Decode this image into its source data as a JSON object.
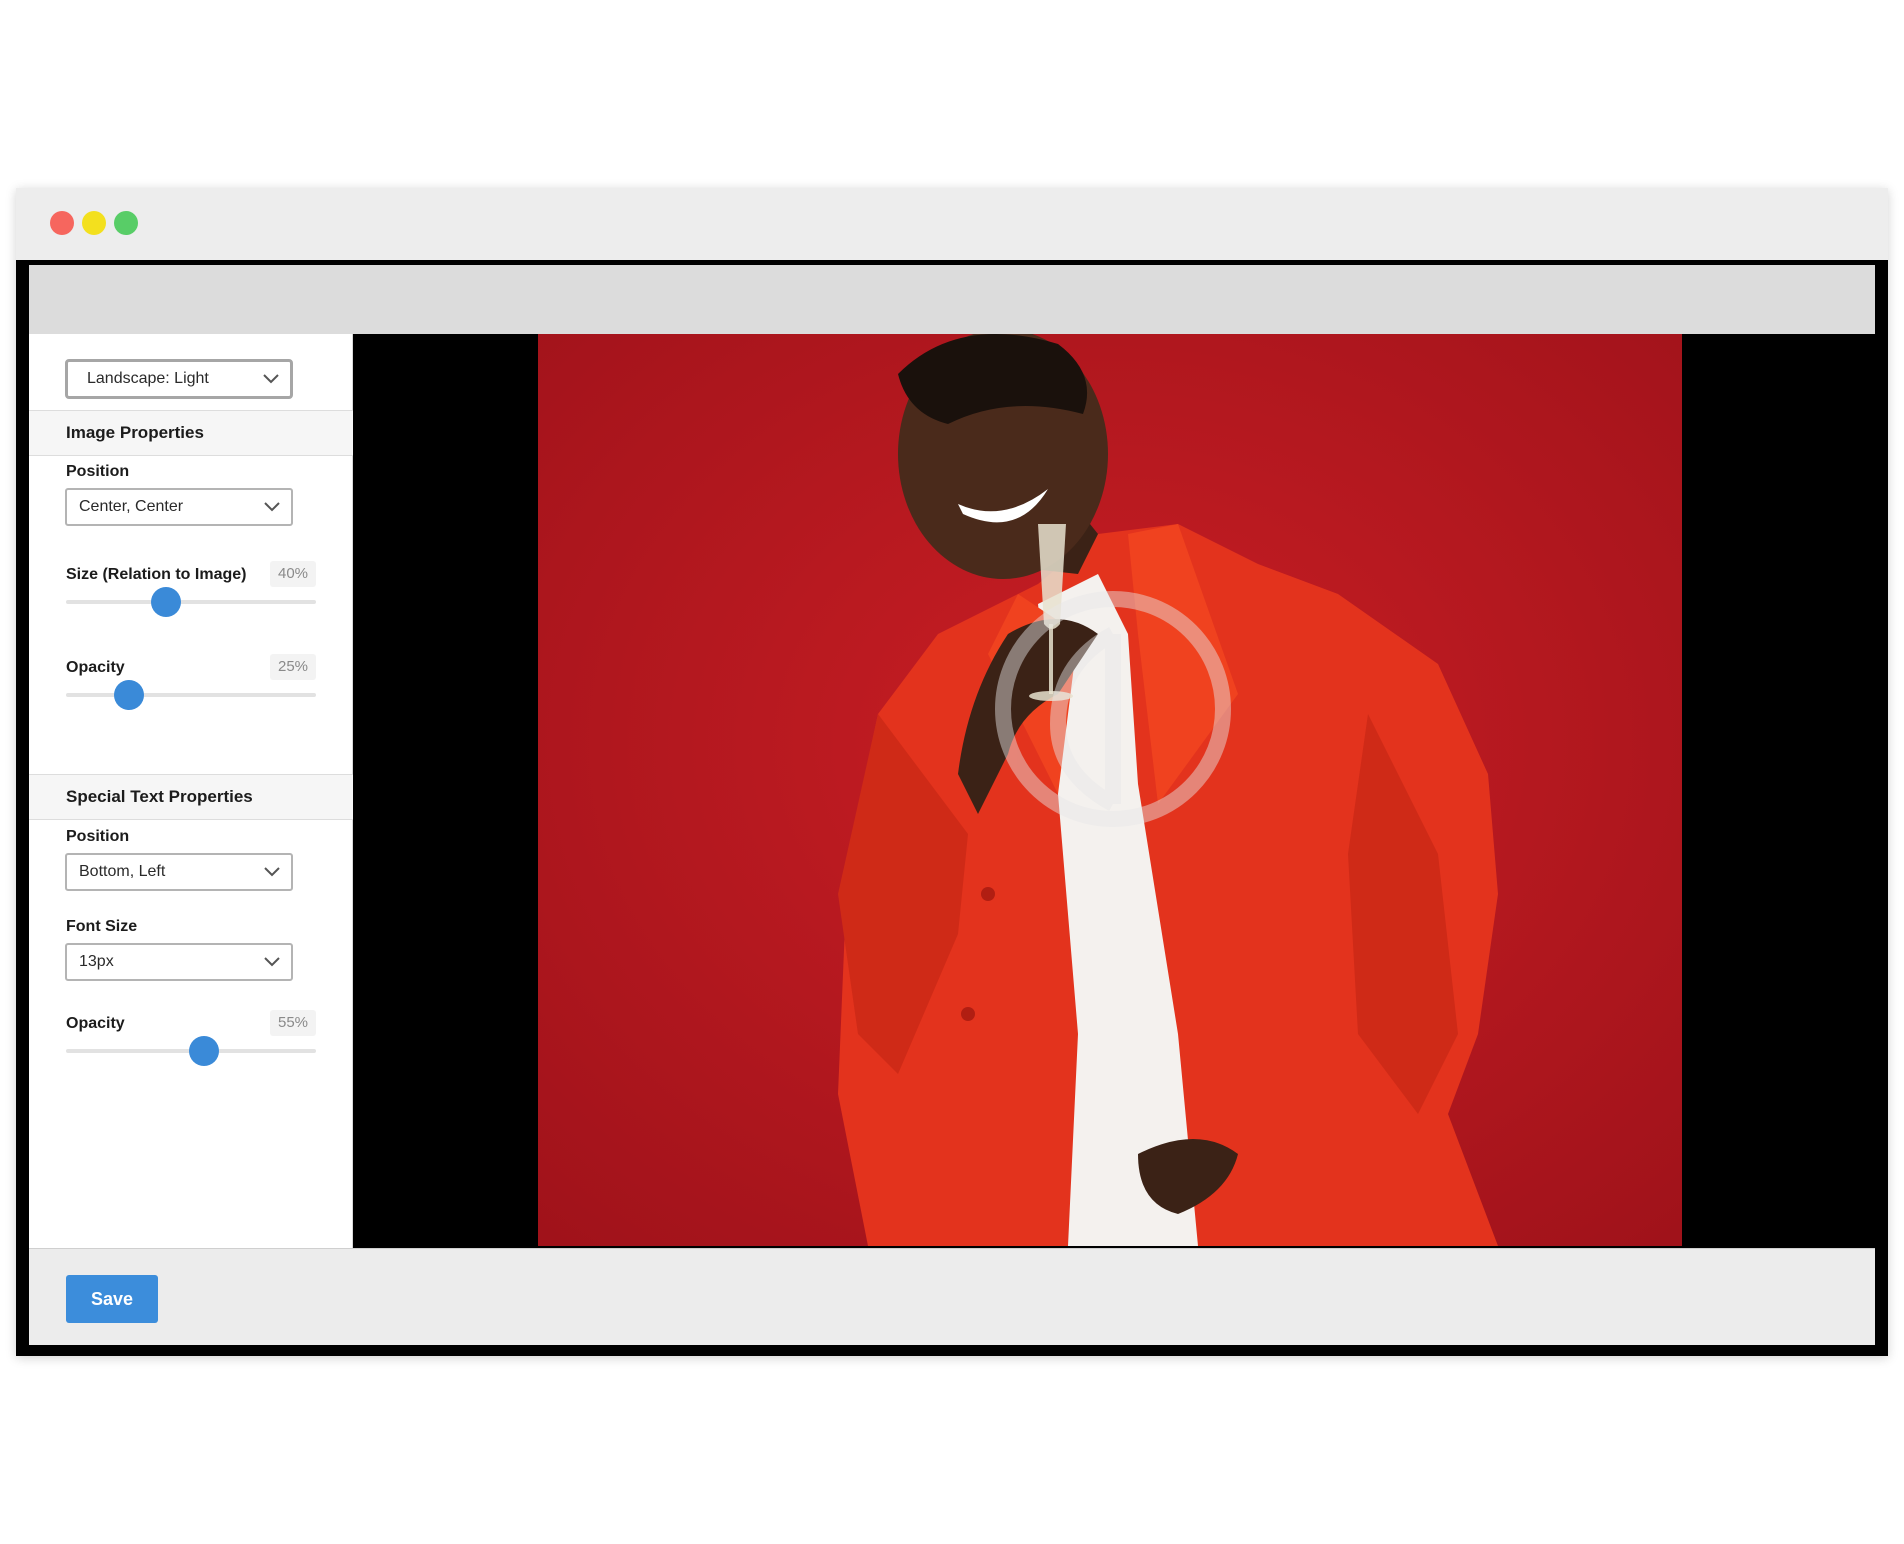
{
  "window": {
    "controls": [
      "close",
      "minimize",
      "maximize"
    ]
  },
  "sidebar": {
    "preset_select": {
      "value": "Landscape: Light"
    },
    "image_properties": {
      "title": "Image Properties",
      "position_label": "Position",
      "position_value": "Center, Center",
      "size_label": "Size (Relation to Image)",
      "size_value": "40%",
      "size_level": 0.4,
      "opacity_label": "Opacity",
      "opacity_value": "25%",
      "opacity_level": 0.25
    },
    "special_text_properties": {
      "title": "Special Text Properties",
      "position_label": "Position",
      "position_value": "Bottom, Left",
      "font_size_label": "Font Size",
      "font_size_value": "13px",
      "opacity_label": "Opacity",
      "opacity_value": "55%",
      "opacity_level": 0.55
    }
  },
  "footer": {
    "save_label": "Save"
  },
  "colors": {
    "accent": "#3a8ad8",
    "photo_background": "#c0191f",
    "jacket": "#e8351e"
  },
  "icons": {
    "select_chevron": "chevron-down-icon",
    "watermark": "watermark-logo-icon"
  }
}
